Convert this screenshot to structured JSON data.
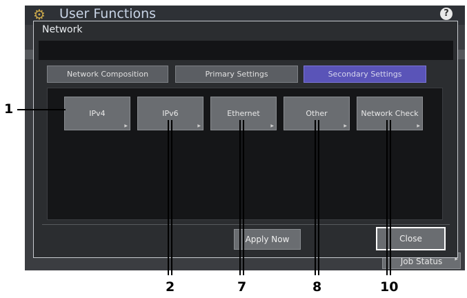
{
  "header": {
    "title": "User Functions",
    "gear_icon": "gear-icon",
    "help_label": "?"
  },
  "behind": {
    "job_status_label": "Job Status"
  },
  "dialog": {
    "title": "Network",
    "tabs": [
      {
        "label": "Network Composition",
        "active": false
      },
      {
        "label": "Primary Settings",
        "active": false
      },
      {
        "label": "Secondary Settings",
        "active": true
      }
    ],
    "buttons": [
      {
        "label": "IPv4"
      },
      {
        "label": "IPv6"
      },
      {
        "label": "Ethernet"
      },
      {
        "label": "Other"
      },
      {
        "label": "Network Check"
      }
    ],
    "apply_label": "Apply Now",
    "close_label": "Close"
  },
  "callouts": [
    "1",
    "2",
    "7",
    "8",
    "10"
  ],
  "colors": {
    "active_tab": "#5a54b8",
    "button": "#6a6d71",
    "panel": "#151618",
    "dialog": "#2b2d30"
  }
}
